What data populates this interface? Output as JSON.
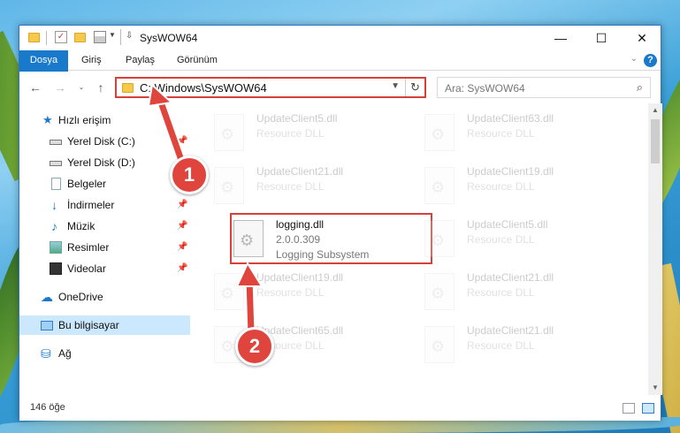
{
  "window": {
    "title": "SysWOW64",
    "controls": {
      "minimize": "—",
      "maximize": "☐",
      "close": "✕"
    }
  },
  "ribbon": {
    "tabs": [
      "Dosya",
      "Giriş",
      "Paylaş",
      "Görünüm"
    ],
    "help": "?"
  },
  "address": {
    "path": "C:\\Windows\\SysWOW64",
    "search_placeholder": "Ara: SysWOW64"
  },
  "sidebar": {
    "items": [
      {
        "label": "Hızlı erişim"
      },
      {
        "label": "Yerel Disk (C:)"
      },
      {
        "label": "Yerel Disk (D:)"
      },
      {
        "label": "Belgeler"
      },
      {
        "label": "İndirmeler"
      },
      {
        "label": "Müzik"
      },
      {
        "label": "Resimler"
      },
      {
        "label": "Videolar"
      },
      {
        "label": "OneDrive"
      },
      {
        "label": "Bu bilgisayar"
      },
      {
        "label": "Ağ"
      }
    ]
  },
  "files": [
    {
      "name": "UpdateClient5.dll",
      "type": "Resource DLL"
    },
    {
      "name": "UpdateClient63.dll",
      "type": "Resource DLL"
    },
    {
      "name": "UpdateClient21.dll",
      "type": "Resource DLL"
    },
    {
      "name": "UpdateClient19.dll",
      "type": "Resource DLL"
    },
    {
      "name": "logging.dll",
      "version": "2.0.0.309",
      "type": "Logging Subsystem"
    },
    {
      "name": "UpdateClient5.dll",
      "type": "Resource DLL"
    },
    {
      "name": "UpdateClient19.dll",
      "type": "Resource DLL"
    },
    {
      "name": "UpdateClient21.dll",
      "type": "Resource DLL"
    },
    {
      "name": "UpdateClient65.dll",
      "type": "Resource DLL"
    },
    {
      "name": "UpdateClient21.dll",
      "type": "Resource DLL"
    }
  ],
  "status": {
    "count": "146 öğe"
  },
  "annotations": {
    "badge1": "1",
    "badge2": "2",
    "accent": "#e0453d"
  }
}
